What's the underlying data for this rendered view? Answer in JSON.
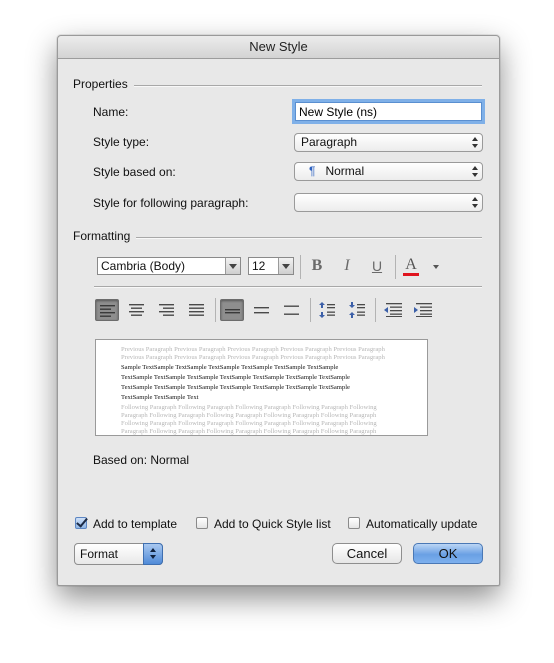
{
  "window": {
    "title": "New Style"
  },
  "properties": {
    "section_label": "Properties",
    "name_label": "Name:",
    "name_value": "New Style (ns)",
    "style_type_label": "Style type:",
    "style_type_value": "Paragraph",
    "based_on_label": "Style based on:",
    "based_on_icon": "¶",
    "based_on_value": "Normal",
    "following_label": "Style for following paragraph:",
    "following_value": ""
  },
  "formatting": {
    "section_label": "Formatting",
    "font_value": "Cambria (Body)",
    "size_value": "12",
    "bold_glyph": "B",
    "italic_glyph": "I",
    "underline_glyph": "U",
    "font_color_glyph": "A",
    "font_color": "#e0141e",
    "alignment_selected": "left",
    "line_spacing_selected": "single"
  },
  "preview": {
    "previous_text": "Previous Paragraph Previous Paragraph Previous Paragraph Previous Paragraph Previous Paragraph Previous Paragraph Previous Paragraph Previous Paragraph Previous Paragraph Previous Paragraph",
    "sample_lines": [
      "Sample TextSample TextSample TextSample TextSample TextSample TextSample",
      "TextSample TextSample TextSample TextSample TextSample TextSample TextSample",
      "TextSample TextSample TextSample TextSample TextSample TextSample TextSample",
      "TextSample TextSample Text"
    ],
    "following_text": "Following Paragraph Following Paragraph Following Paragraph Following Paragraph Following Paragraph Following Paragraph Following Paragraph Following Paragraph Following Paragraph Following Paragraph Following Paragraph Following Paragraph Following Paragraph Following Paragraph Following Paragraph Following Paragraph Following Paragraph Following Paragraph Following Paragraph Following Paragraph Following Paragraph Following Paragraph Following Paragraph Following Paragraph"
  },
  "description": "Based on: Normal",
  "options": {
    "add_to_template": {
      "label": "Add to template",
      "checked": true
    },
    "add_to_quick_style": {
      "label": "Add to Quick Style list",
      "checked": false
    },
    "auto_update": {
      "label": "Automatically update",
      "checked": false
    }
  },
  "buttons": {
    "format_label": "Format",
    "cancel_label": "Cancel",
    "ok_label": "OK"
  }
}
